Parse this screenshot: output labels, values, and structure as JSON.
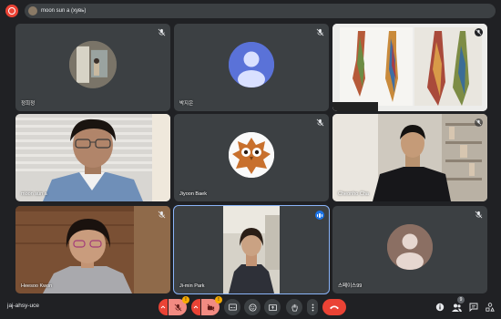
{
  "colors": {
    "background": "#202124",
    "tile": "#3c4043",
    "red": "#ea4335",
    "blue": "#1a73e8",
    "speaking_outline": "#8ab4f8"
  },
  "topbar": {
    "presenter_label": "moon sun a (хувь)"
  },
  "tiles": [
    {
      "name": "정희정",
      "mic": "muted"
    },
    {
      "name": "박지은",
      "mic": "muted"
    },
    {
      "name": "",
      "mic": "muted",
      "content": "shared-screen-photo"
    },
    {
      "name": "moon sun a",
      "mic": "none"
    },
    {
      "name": "Jiyoon Baek",
      "mic": "muted"
    },
    {
      "name": "Cheonho Cha",
      "mic": "muted"
    },
    {
      "name": "Heesoo Kwon",
      "mic": "muted"
    },
    {
      "name": "Ji-min Park",
      "mic": "speaking"
    },
    {
      "name": "스페이스99",
      "mic": "muted"
    }
  ],
  "bottombar": {
    "meeting_code": "jaj-ahsy-uce",
    "people_count": "9",
    "mic_badge": "!",
    "cam_badge": "!"
  },
  "icons": {
    "record": "record-icon",
    "mic_muted": "mic-off-icon",
    "cam_off": "camera-off-icon",
    "captions": "captions-icon",
    "emoji": "emoji-icon",
    "present": "present-icon",
    "raise_hand": "raise-hand-icon",
    "more": "more-vert-icon",
    "end_call": "end-call-icon",
    "info": "info-icon",
    "people": "people-icon",
    "chat": "chat-icon",
    "activities": "activities-icon"
  }
}
